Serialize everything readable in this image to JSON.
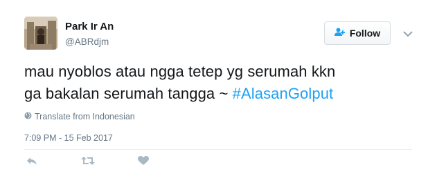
{
  "user": {
    "name": "Park Ir An",
    "handle": "@ABRdjm"
  },
  "follow_button": {
    "label": "Follow"
  },
  "tweet": {
    "text_line1": "mau nyoblos atau ngga tetep yg serumah kkn",
    "text_line2_prefix": "ga bakalan serumah tangga ~ ",
    "hashtag": "#AlasanGolput"
  },
  "translate_label": "Translate from Indonesian",
  "timestamp": "7:09 PM - 15 Feb 2017",
  "colors": {
    "accent": "#1da1f2",
    "secondary_text": "#657786",
    "action_icon": "#aab8c2"
  },
  "icons": [
    "user-plus-icon",
    "chevron-down-icon",
    "globe-icon",
    "reply-icon",
    "retweet-icon",
    "heart-icon"
  ]
}
